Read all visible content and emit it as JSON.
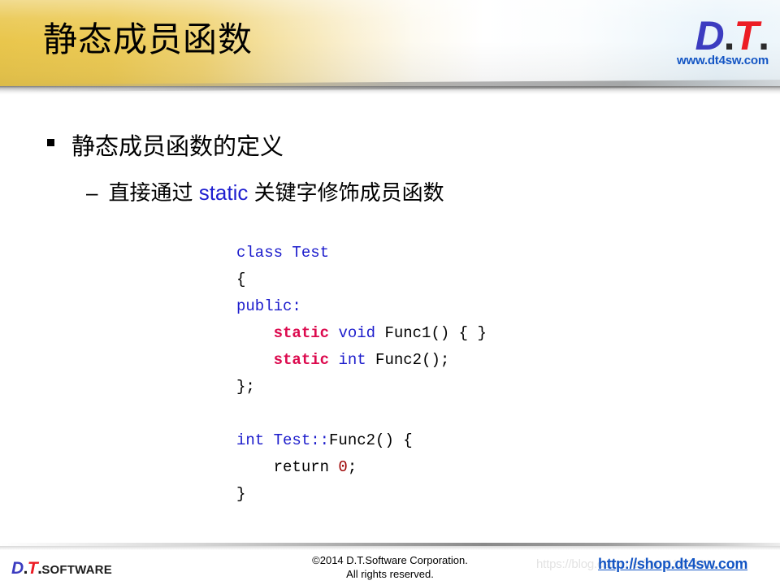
{
  "slide": {
    "title": "静态成员函数",
    "background_color": "#ffffff"
  },
  "header": {
    "gradient_from": "#e9c64c",
    "gradient_to": "#eef6fb",
    "logo": {
      "d_letter": "D",
      "dot1": ".",
      "t_letter": "T",
      "dot2": ".",
      "url": "www.dt4sw.com",
      "d_color": "#3c3cc0",
      "t_color": "#ec1c24",
      "url_color": "#1355c4"
    }
  },
  "content": {
    "bullet_level1": {
      "marker": "square-bullet",
      "text": "静态成员函数的定义"
    },
    "bullet_level2": {
      "marker": "–",
      "text_before": "直接通过 ",
      "keyword": "static",
      "keyword_color": "#1f1fd0",
      "text_after": " 关键字修饰成员函数"
    },
    "code": {
      "language": "cpp",
      "colors": {
        "keyword": "#1c1ccc",
        "static": "#dc0a4e",
        "number": "#9c0000",
        "plain": "#000000"
      },
      "lines": [
        [
          {
            "t": "class Test",
            "c": "key"
          }
        ],
        [
          {
            "t": "{",
            "c": "plain"
          }
        ],
        [
          {
            "t": "public:",
            "c": "key"
          }
        ],
        [
          {
            "t": "    ",
            "c": "plain"
          },
          {
            "t": "static",
            "c": "static"
          },
          {
            "t": " ",
            "c": "plain"
          },
          {
            "t": "void",
            "c": "key"
          },
          {
            "t": " Func1() { }",
            "c": "plain"
          }
        ],
        [
          {
            "t": "    ",
            "c": "plain"
          },
          {
            "t": "static",
            "c": "static"
          },
          {
            "t": " ",
            "c": "plain"
          },
          {
            "t": "int",
            "c": "key"
          },
          {
            "t": " Func2();",
            "c": "plain"
          }
        ],
        [
          {
            "t": "};",
            "c": "plain"
          }
        ],
        [],
        [
          {
            "t": "int Test::",
            "c": "key"
          },
          {
            "t": "Func2() {",
            "c": "plain"
          }
        ],
        [
          {
            "t": "    return ",
            "c": "plain"
          },
          {
            "t": "0",
            "c": "num"
          },
          {
            "t": ";",
            "c": "plain"
          }
        ],
        [
          {
            "t": "}",
            "c": "plain"
          }
        ]
      ]
    }
  },
  "footer": {
    "logo": {
      "d_letter": "D",
      "dot1": ".",
      "t_letter": "T",
      "dot2": ".",
      "word_cap": "S",
      "word_rest": "OFTWARE"
    },
    "copyright_line1": "©2014 D.T.Software Corporation.",
    "copyright_line2": "All rights reserved.",
    "shop_watermark": "https://blog.csdn.net/qq_41854911",
    "shop_link": "http://shop.dt4sw.com",
    "shop_link_color": "#1355c4"
  }
}
